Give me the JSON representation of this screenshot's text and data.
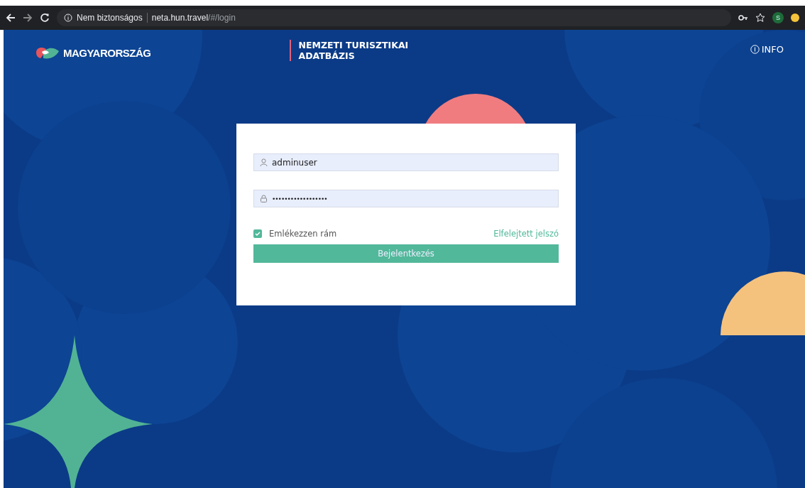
{
  "browser": {
    "security_label": "Nem biztonságos",
    "url_host": "neta.hun.travel",
    "url_path": "/#/login",
    "profile_initial": "S"
  },
  "header": {
    "logo_text": "MAGYARORSZÁG",
    "title_line_1": "NEMZETI TURISZTIKAI",
    "title_line_2": "ADATBÁZIS",
    "info_link": "INFO"
  },
  "login": {
    "username": {
      "value": "adminuser"
    },
    "password": {
      "masked_value": "••••••••••••••••••"
    },
    "remember_me": {
      "label": "Emlékezzen rám",
      "checked": true
    },
    "forgot_link": "Elfelejtett jelszó",
    "submit_button": "Bejelentkezés"
  }
}
